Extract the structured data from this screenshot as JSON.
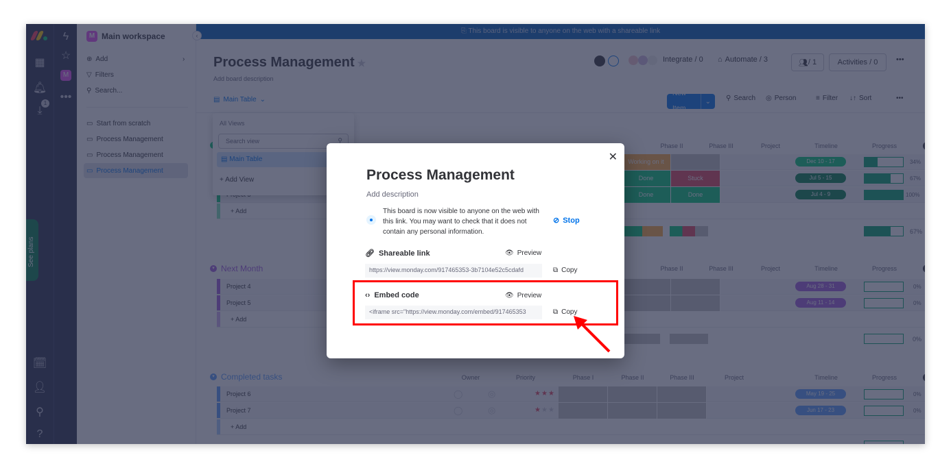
{
  "rail": {
    "logo_colors": [
      "#ff3d57",
      "#ffcb00",
      "#00ca72"
    ],
    "notification_count": "1",
    "see_plans": "See plans"
  },
  "workspace": {
    "name": "Main workspace",
    "avatar_letter": "M",
    "add": "Add",
    "filters": "Filters",
    "search": "Search...",
    "boards": [
      {
        "label": "Start from scratch",
        "active": false
      },
      {
        "label": "Process Management",
        "active": false
      },
      {
        "label": "Process Management",
        "active": false
      },
      {
        "label": "Process Management",
        "active": true
      }
    ]
  },
  "banner": "This board is visible to anyone on the web with a shareable link",
  "board": {
    "title": "Process Management",
    "description": "Add board description",
    "view": "Main Table",
    "integrate": "Integrate / 0",
    "automate": "Automate / 3",
    "members": "/ 1",
    "activities": "Activities / 0",
    "new_item": "New Item",
    "search": "Search",
    "person": "Person",
    "filter": "Filter",
    "sort": "Sort"
  },
  "views_dropdown": {
    "label": "All Views",
    "search_placeholder": "Search view",
    "main_table": "Main Table",
    "add_view": "+ Add View"
  },
  "columns": [
    "Owner",
    "Priority",
    "Phase I",
    "Phase II",
    "Phase III",
    "Project",
    "Timeline",
    "Progress"
  ],
  "groups": [
    {
      "title": "",
      "color": "#00c875",
      "rows": [
        {
          "name": "",
          "phase2": "Working on it",
          "phase3": "",
          "timeline": "Dec 10 - 17",
          "progress": 34
        },
        {
          "name": "",
          "phase2": "Done",
          "phase3": "Stuck",
          "timeline": "Jul 5 - 15",
          "progress": 67
        },
        {
          "name": "Project 3",
          "phase2": "Done",
          "phase3": "Done",
          "timeline": "Jul 4 - 9",
          "progress": 100
        }
      ],
      "summary_progress": 67
    },
    {
      "title": "Next Month",
      "color": "#a25ddc",
      "rows": [
        {
          "name": "Project 4",
          "timeline": "Aug 28 - 31",
          "progress": 0
        },
        {
          "name": "Project 5",
          "timeline": "Aug 11 - 14",
          "progress": 0
        }
      ],
      "summary_progress": 0
    },
    {
      "title": "Completed tasks",
      "color": "#579bfc",
      "rows": [
        {
          "name": "Project 6",
          "priority": 3,
          "timeline": "May 19 - 25",
          "progress": 0
        },
        {
          "name": "Project 7",
          "priority": 1,
          "timeline": "Jun 17 - 23",
          "progress": 0
        }
      ]
    }
  ],
  "add_row": "+ Add",
  "modal": {
    "title": "Process Management",
    "description": "Add description",
    "notice": "This board is now visible to anyone on the web with this link. You may want to check that it does not contain any personal information.",
    "stop": "Stop",
    "shareable_label": "Shareable link",
    "shareable_url": "https://view.monday.com/917465353-3b7104e52c5cdafd",
    "embed_label": "Embed code",
    "embed_code": "<iframe src=\"https://view.monday.com/embed/917465353",
    "preview": "Preview",
    "copy": "Copy"
  },
  "colors": {
    "status_working": "#fdab3d",
    "status_done": "#00c875",
    "status_stuck": "#e2445c",
    "progress": "#00a36c",
    "accent": "#0073ea"
  }
}
